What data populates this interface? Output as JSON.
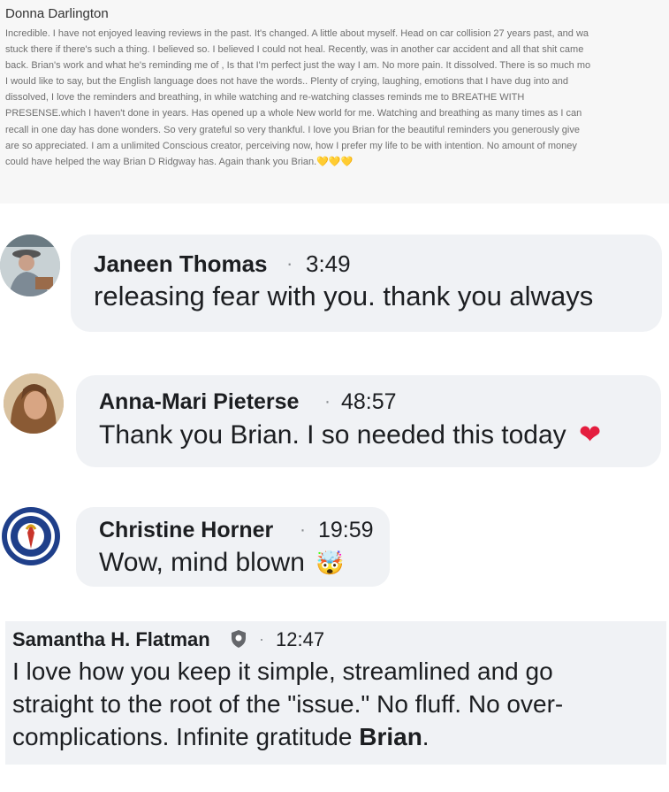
{
  "review": {
    "author": "Donna Darlington",
    "lines": [
      "Incredible. I have not enjoyed leaving reviews in the past. It's changed. A little about myself. Head on car collision 27 years past, and wa",
      "stuck there if there's such a thing. I believed so. I believed I could not heal. Recently, was in another car accident and all that shit came",
      "back. Brian's work and what he's reminding me of , Is that I'm perfect just the way I am. No more pain. It dissolved. There is so much mo",
      "I would like to say, but the English language does not have the words.. Plenty of crying, laughing, emotions that I have dug into and",
      "dissolved, I love the reminders and breathing, in while watching and re-watching classes reminds me to BREATHE WITH",
      "PRESENSE.which I haven't done in years. Has opened up a whole New world for me. Watching and breathing as many times as I can",
      "recall in one day has done wonders. So very grateful so very thankful. I love you Brian for the beautiful reminders you generously give",
      "are so appreciated. I am a unlimited Conscious creator, perceiving now, how I prefer my life to be with intention. No amount of money",
      "could have helped the way Brian D Ridgway has. Again thank you Brian."
    ],
    "hearts": "💛💛💛"
  },
  "comments": [
    {
      "name": "Janeen Thomas",
      "sep": "·",
      "time": "3:49",
      "message": "releasing fear with you. thank you always"
    },
    {
      "name": "Anna-Mari Pieterse",
      "sep": "·",
      "time": "48:57",
      "message": "Thank you Brian. I so needed this today",
      "emoji": "❤"
    },
    {
      "name": "Christine Horner",
      "sep": "·",
      "time": "19:59",
      "message": "Wow, mind blown",
      "emoji": "🤯"
    }
  ],
  "last_comment": {
    "name": "Samantha H. Flatman",
    "sep": "·",
    "time": "12:47",
    "lines": [
      "I love how you keep it simple, streamlined and go",
      "straight to the root of the \"issue.\" No fluff. No over-",
      "complications. Infinite gratitude"
    ],
    "bold_end": "Brian",
    "end_punct": "."
  },
  "colors": {
    "bubble": "#f0f2f5",
    "heart": "#e41e3f",
    "review_bg": "#f7f7f7"
  },
  "icons": [
    "shield-badge-icon",
    "red-heart-emoji",
    "exploding-head-emoji",
    "yellow-heart-emoji"
  ]
}
